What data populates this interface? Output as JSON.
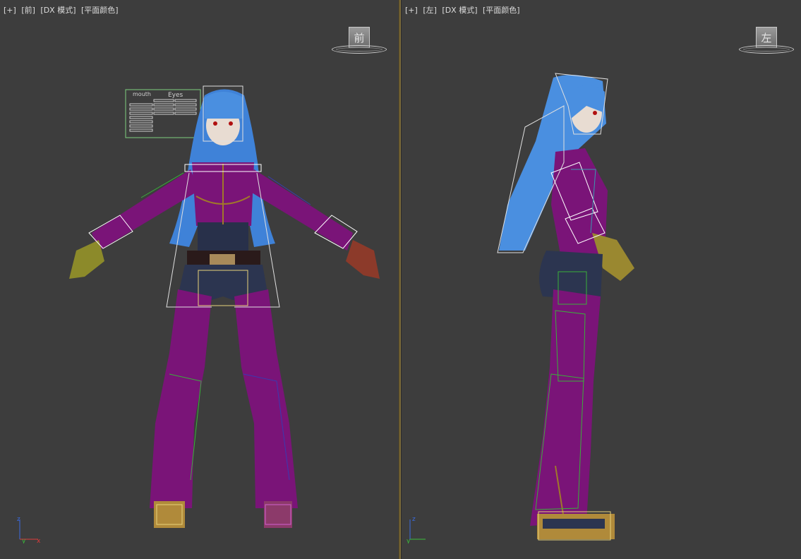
{
  "viewports": {
    "left": {
      "labels": [
        "[+]",
        "[前]",
        "[DX 模式]",
        "[平面颜色]"
      ],
      "viewcube_face": "前"
    },
    "right": {
      "labels": [
        "[+]",
        "[左]",
        "[DX 模式]",
        "[平面颜色]"
      ],
      "viewcube_face": "左"
    }
  },
  "facial_panel": {
    "mouth_label": "mouth",
    "eyes_label": "Eyes"
  },
  "axis": {
    "x": "x",
    "y": "y",
    "z": "z"
  },
  "colors": {
    "viewport_bg": "#3d3d3d",
    "hair": "#4a8fe0",
    "suit": "#7a1478",
    "divider": "#7a6a3a"
  }
}
